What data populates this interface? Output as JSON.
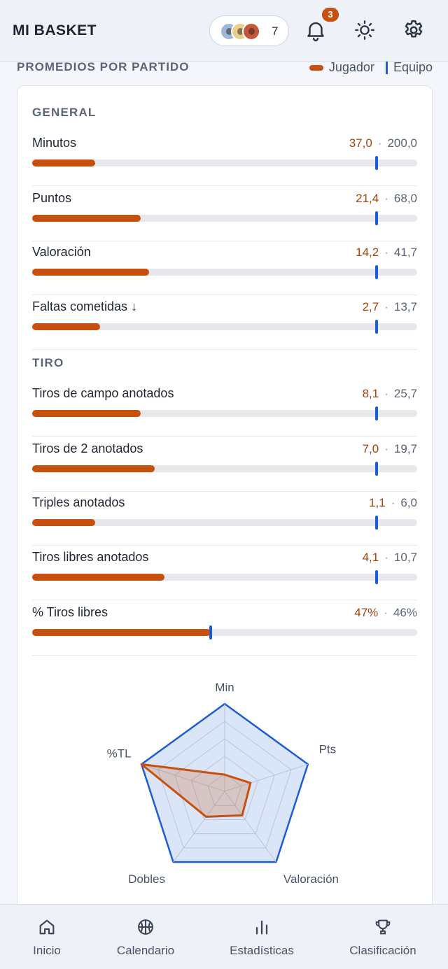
{
  "app": {
    "title": "MI BASKET"
  },
  "header": {
    "team_count": "7",
    "notifications": "3"
  },
  "section": {
    "title": "PROMEDIOS POR PARTIDO",
    "legend": {
      "player": "Jugador",
      "team": "Equipo"
    }
  },
  "groups": {
    "general": "GENERAL",
    "tiro": "TIRO"
  },
  "stats": [
    {
      "name": "Minutos",
      "player": "37,0",
      "team": "200,0",
      "player_frac": 0.163,
      "team_frac": 0.895
    },
    {
      "name": "Puntos",
      "player": "21,4",
      "team": "68,0",
      "player_frac": 0.281,
      "team_frac": 0.895
    },
    {
      "name": "Valoración",
      "player": "14,2",
      "team": "41,7",
      "player_frac": 0.304,
      "team_frac": 0.895
    },
    {
      "name": "Faltas cometidas ↓",
      "player": "2,7",
      "team": "13,7",
      "player_frac": 0.177,
      "team_frac": 0.895
    },
    {
      "name": "Tiros de campo anotados",
      "player": "8,1",
      "team": "25,7",
      "player_frac": 0.281,
      "team_frac": 0.895
    },
    {
      "name": "Tiros de 2 anotados",
      "player": "7,0",
      "team": "19,7",
      "player_frac": 0.318,
      "team_frac": 0.895
    },
    {
      "name": "Triples anotados",
      "player": "1,1",
      "team": "6,0",
      "player_frac": 0.163,
      "team_frac": 0.895
    },
    {
      "name": "Tiros libres anotados",
      "player": "4,1",
      "team": "10,7",
      "player_frac": 0.343,
      "team_frac": 0.895
    },
    {
      "name": "% Tiros libres",
      "player": "47%",
      "team": "46%",
      "player_frac": 0.463,
      "team_frac": 0.463
    }
  ],
  "chart_data": {
    "type": "radar",
    "axes": [
      "Min",
      "Pts",
      "Valoración",
      "Dobles",
      "%TL"
    ],
    "series": [
      {
        "name": "Jugador",
        "values": [
          0.19,
          0.31,
          0.34,
          0.36,
          1.0
        ],
        "color": "#c8500e"
      },
      {
        "name": "Equipo",
        "values": [
          1.0,
          1.0,
          1.0,
          1.0,
          1.0
        ],
        "color": "#1e5bd6"
      }
    ],
    "rings": 5
  },
  "nav": [
    {
      "label": "Inicio",
      "icon": "home-icon"
    },
    {
      "label": "Calendario",
      "icon": "basketball-icon"
    },
    {
      "label": "Estadísticas",
      "icon": "bar-chart-icon"
    },
    {
      "label": "Clasificación",
      "icon": "trophy-icon"
    }
  ],
  "colors": {
    "accent": "#c8500e",
    "team": "#1e5bd6"
  }
}
